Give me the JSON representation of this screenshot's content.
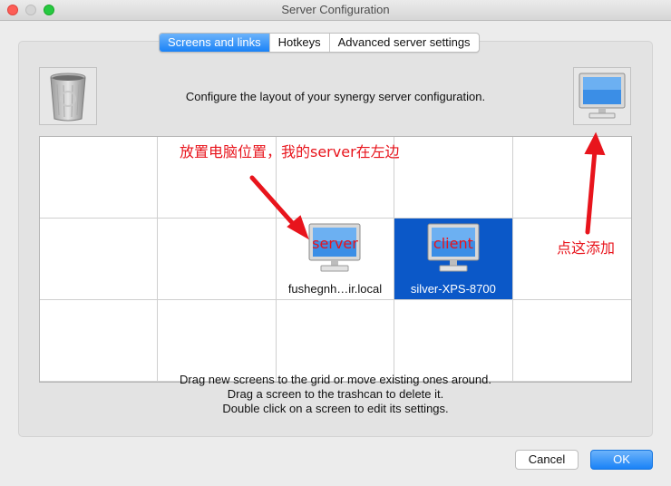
{
  "window": {
    "title": "Server Configuration"
  },
  "tabs": [
    {
      "label": "Screens and links",
      "active": true
    },
    {
      "label": "Hotkeys",
      "active": false
    },
    {
      "label": "Advanced server settings",
      "active": false
    }
  ],
  "main": {
    "description": "Configure the layout of your synergy server configuration.",
    "trash_icon": "trash-can-icon",
    "add_screen_icon": "monitor-icon"
  },
  "grid": {
    "columns": 5,
    "rows": 3,
    "screens": [
      {
        "label": "fushegnh…ir.local",
        "overlay_text": "server",
        "row": 1,
        "col": 2,
        "selected": false
      },
      {
        "label": "silver-XPS-8700",
        "overlay_text": "client",
        "row": 1,
        "col": 3,
        "selected": true
      }
    ]
  },
  "help": {
    "lines": [
      "Drag new screens to the grid or move existing ones around.",
      "Drag a screen to the trashcan to delete it.",
      "Double click on a screen to edit its settings."
    ]
  },
  "buttons": {
    "cancel": "Cancel",
    "ok": "OK"
  },
  "annotations": {
    "top_note": "放置电脑位置，我的server在左边",
    "add_note": "点这添加",
    "color": "#e8141c"
  },
  "colors": {
    "accent": "#1a82f7",
    "selection": "#0b58c8"
  }
}
